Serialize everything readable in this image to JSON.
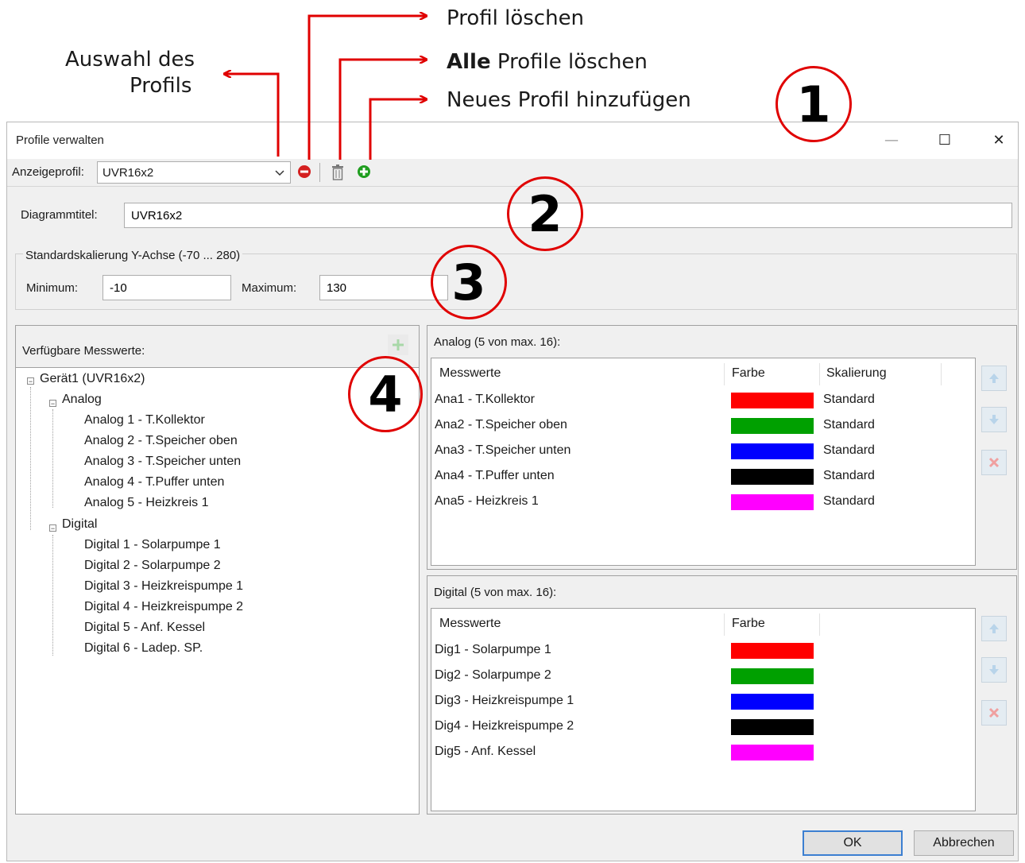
{
  "annotations": {
    "auswahl_line1": "Auswahl des",
    "auswahl_line2": "Profils",
    "profil_loeschen": "Profil löschen",
    "alle_bold": "Alle",
    "alle_rest": " Profile löschen",
    "neues_profil": "Neues Profil hinzufügen",
    "callouts": [
      "1",
      "2",
      "3",
      "4"
    ]
  },
  "window": {
    "title": "Profile verwalten",
    "minimize": "—",
    "maximize": "☐",
    "close": "✕"
  },
  "toolbar": {
    "profile_label": "Anzeigeprofil:",
    "profile_value": "UVR16x2"
  },
  "diagram": {
    "title_label": "Diagrammtitel:",
    "title_value": "UVR16x2"
  },
  "scaling": {
    "group_label": "Standardskalierung Y-Achse (-70 ... 280)",
    "min_label": "Minimum:",
    "min_value": "-10",
    "max_label": "Maximum:",
    "max_value": "130"
  },
  "available": {
    "label": "Verfügbare Messwerte:",
    "device": "Gerät1 (UVR16x2)",
    "analog_label": "Analog",
    "analog_items": [
      "Analog 1 - T.Kollektor",
      "Analog 2 - T.Speicher oben",
      "Analog 3 - T.Speicher unten",
      "Analog 4 - T.Puffer unten",
      "Analog 5 - Heizkreis 1"
    ],
    "digital_label": "Digital",
    "digital_items": [
      "Digital 1 - Solarpumpe 1",
      "Digital 2 - Solarpumpe 2",
      "Digital 3 - Heizkreispumpe 1",
      "Digital 4 - Heizkreispumpe 2",
      "Digital 5 - Anf. Kessel",
      "Digital 6 - Ladep. SP."
    ]
  },
  "analog_panel": {
    "title": "Analog (5 von max. 16):",
    "col_values": "Messwerte",
    "col_color": "Farbe",
    "col_scaling": "Skalierung",
    "rows": [
      {
        "name": "Ana1 - T.Kollektor",
        "color": "#ff0000",
        "scaling": "Standard"
      },
      {
        "name": "Ana2 - T.Speicher oben",
        "color": "#00a000",
        "scaling": "Standard"
      },
      {
        "name": "Ana3 - T.Speicher unten",
        "color": "#0000ff",
        "scaling": "Standard"
      },
      {
        "name": "Ana4 - T.Puffer unten",
        "color": "#000000",
        "scaling": "Standard"
      },
      {
        "name": "Ana5 - Heizkreis 1",
        "color": "#ff00ff",
        "scaling": "Standard"
      }
    ]
  },
  "digital_panel": {
    "title": "Digital (5 von max. 16):",
    "col_values": "Messwerte",
    "col_color": "Farbe",
    "rows": [
      {
        "name": "Dig1 - Solarpumpe 1",
        "color": "#ff0000"
      },
      {
        "name": "Dig2 - Solarpumpe 2",
        "color": "#00a000"
      },
      {
        "name": "Dig3 - Heizkreispumpe 1",
        "color": "#0000ff"
      },
      {
        "name": "Dig4 - Heizkreispumpe 2",
        "color": "#000000"
      },
      {
        "name": "Dig5 - Anf. Kessel",
        "color": "#ff00ff"
      }
    ]
  },
  "footer": {
    "ok": "OK",
    "cancel": "Abbrechen"
  }
}
